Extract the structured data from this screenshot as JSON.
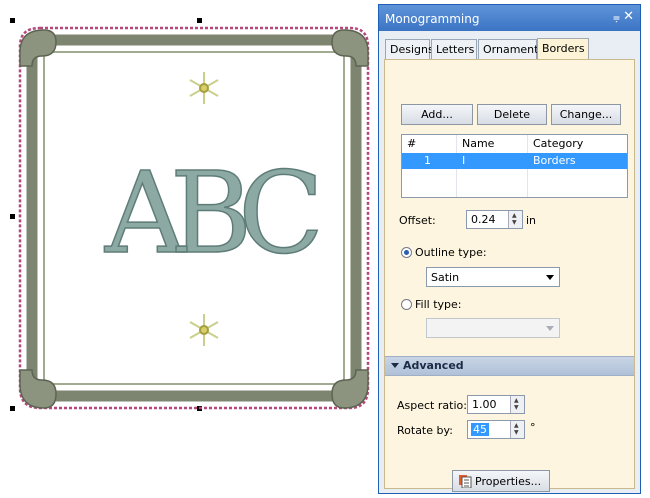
{
  "panel": {
    "title": "Monogramming",
    "pin_glyph": "⩦",
    "close_glyph": "✕",
    "tabs": [
      {
        "label": "Designs",
        "active": false
      },
      {
        "label": "Letters",
        "active": false
      },
      {
        "label": "Ornaments",
        "active": false
      },
      {
        "label": "Borders",
        "active": true
      }
    ],
    "buttons": {
      "add": "Add...",
      "delete": "Delete",
      "change": "Change..."
    },
    "table": {
      "columns": [
        "#",
        "Name",
        "Category"
      ],
      "rows": [
        {
          "num": "1",
          "name": "I",
          "category": "Borders"
        }
      ]
    },
    "offset": {
      "label": "Offset:",
      "value": "0.24",
      "unit": "in"
    },
    "outline": {
      "label": "Outline type:",
      "selected": true,
      "value": "Satin"
    },
    "fill": {
      "label": "Fill type:",
      "selected": false,
      "value": ""
    },
    "advanced": {
      "label": "Advanced"
    },
    "aspect_ratio": {
      "label": "Aspect ratio:",
      "value": "1.00"
    },
    "rotate": {
      "label": "Rotate by:",
      "value": "45",
      "unit": "°"
    },
    "properties_button": "Properties..."
  },
  "design": {
    "letters": "ABC",
    "colors": {
      "frame": "#8c9480",
      "thread_outline": "#b5477b",
      "letters": "#8da9a4",
      "star": "#c9d08b"
    }
  }
}
